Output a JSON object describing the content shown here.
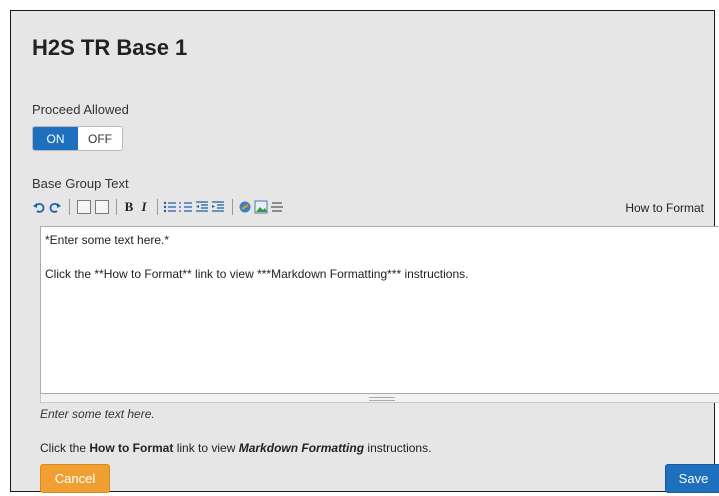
{
  "page": {
    "title": "H2S TR Base 1"
  },
  "proceed": {
    "label": "Proceed Allowed",
    "on_label": "ON",
    "off_label": "OFF",
    "selected": "ON"
  },
  "base_group": {
    "label": "Base Group Text",
    "how_to_format": "How to Format",
    "toolbar": [
      "undo-icon",
      "redo-icon",
      "page-icon",
      "page-preview-icon",
      "bold-icon",
      "italic-icon",
      "bulleted-list-icon",
      "numbered-list-icon",
      "outdent-icon",
      "indent-icon",
      "link-icon",
      "image-icon",
      "horizontal-rule-icon"
    ],
    "editor_line1": "*Enter some text here.*",
    "editor_line2": "Click the **How to Format** link to view ***Markdown Formatting*** instructions."
  },
  "preview": {
    "line1": "Enter some text here.",
    "line2_pre": "Click the ",
    "line2_bold": "How to Format",
    "line2_mid": " link to view ",
    "line2_bolditalic": "Markdown Formatting",
    "line2_post": " instructions."
  },
  "buttons": {
    "cancel": "Cancel",
    "save": "Save"
  },
  "colors": {
    "primary": "#1f6fbf",
    "cancel": "#f0a033",
    "panel": "#e6e6e6"
  }
}
